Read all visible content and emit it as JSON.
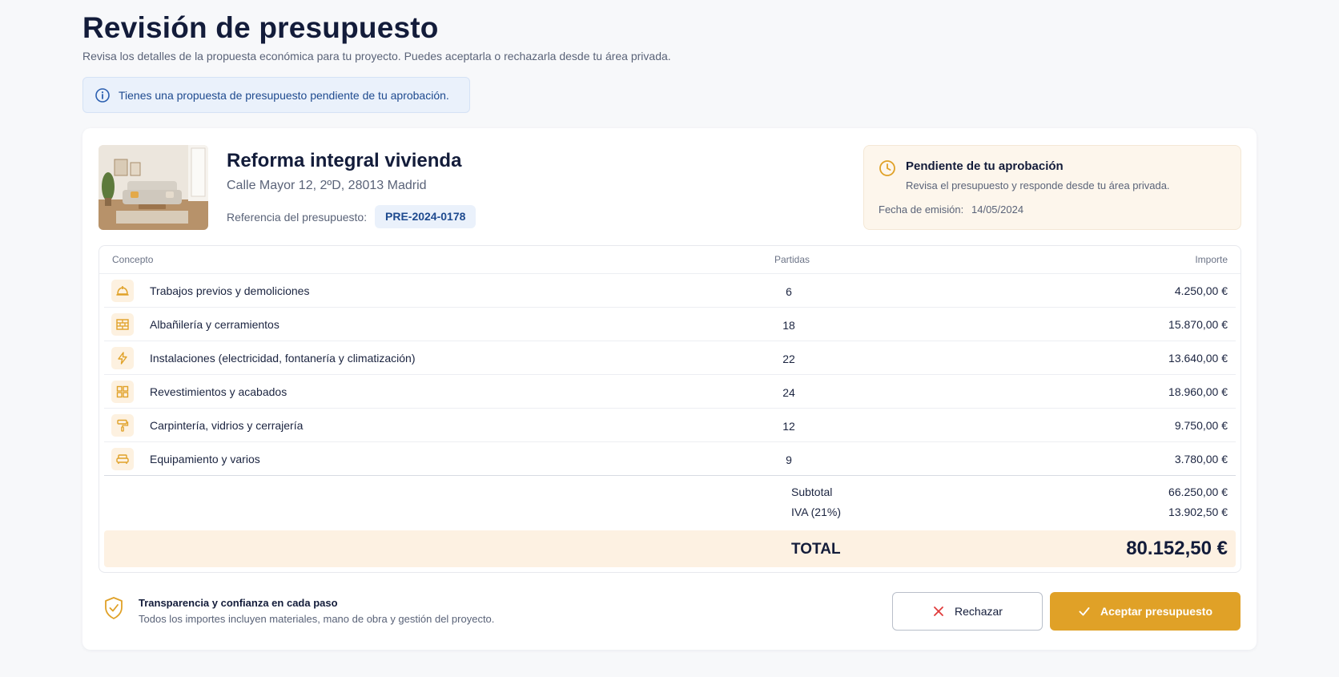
{
  "header": {
    "title": "Revisión de presupuesto",
    "subtitle": "Revisa los detalles de la propuesta económica para tu proyecto. Puedes aceptarla o rechazarla desde tu área privada."
  },
  "banner": {
    "icon": "info-icon",
    "text": "Tienes una propuesta de presupuesto pendiente de tu aprobación."
  },
  "project": {
    "title": "Reforma integral vivienda",
    "address": "Calle Mayor 12, 2ºD, 28013 Madrid",
    "reference_label": "Referencia del presupuesto:",
    "reference": "PRE-2024-0178"
  },
  "status": {
    "icon": "clock-icon",
    "title": "Pendiente de tu aprobación",
    "description": "Revisa el presupuesto y responde desde tu área privada.",
    "date_label": "Fecha de emisión:",
    "date": "14/05/2024"
  },
  "table": {
    "headers": {
      "concept": "Concepto",
      "items": "Partidas",
      "amount": "Importe"
    },
    "rows": [
      {
        "icon": "hard-hat-icon",
        "concept": "Trabajos previos y demoliciones",
        "items": "6",
        "amount": "4.250,00 €"
      },
      {
        "icon": "bricks-icon",
        "concept": "Albañilería y cerramientos",
        "items": "18",
        "amount": "15.870,00 €"
      },
      {
        "icon": "lightning-icon",
        "concept": "Instalaciones (electricidad, fontanería y climatización)",
        "items": "22",
        "amount": "13.640,00 €"
      },
      {
        "icon": "tiles-icon",
        "concept": "Revestimientos y acabados",
        "items": "24",
        "amount": "18.960,00 €"
      },
      {
        "icon": "paint-roller-icon",
        "concept": "Carpintería, vidrios y cerrajería",
        "items": "12",
        "amount": "9.750,00 €"
      },
      {
        "icon": "sofa-icon",
        "concept": "Equipamiento y varios",
        "items": "9",
        "amount": "3.780,00 €"
      }
    ],
    "subtotal_label": "Subtotal",
    "subtotal": "66.250,00 €",
    "vat_label": "IVA (21%)",
    "vat": "13.902,50 €",
    "total_label": "TOTAL",
    "total": "80.152,50 €"
  },
  "footer": {
    "icon": "shield-check-icon",
    "title": "Transparencia y confianza en cada paso",
    "description": "Todos los importes incluyen materiales, mano de obra y gestión del proyecto."
  },
  "actions": {
    "reject_label": "Rechazar",
    "accept_label": "Aceptar presupuesto"
  },
  "colors": {
    "accent": "#e0a127",
    "info": "#1e4a8f",
    "reject_icon": "#e03b3b"
  }
}
